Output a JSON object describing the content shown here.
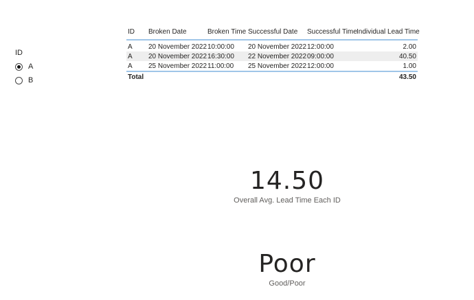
{
  "slicer": {
    "title": "ID",
    "options": [
      {
        "label": "A",
        "selected": true
      },
      {
        "label": "B",
        "selected": false
      }
    ]
  },
  "table": {
    "headers": [
      "ID",
      "Broken Date",
      "Broken Time",
      "Successful Date",
      "Successful Time",
      "Individual Lead Time"
    ],
    "rows": [
      [
        "A",
        "20 November 2022",
        "10:00:00",
        "20 November 2022",
        "12:00:00",
        "2.00"
      ],
      [
        "A",
        "20 November 2022",
        "16:30:00",
        "22 November 2022",
        "09:00:00",
        "40.50"
      ],
      [
        "A",
        "25 November 2022",
        "11:00:00",
        "25 November 2022",
        "12:00:00",
        "1.00"
      ]
    ],
    "total": {
      "label": "Total",
      "value": "43.50"
    }
  },
  "cards": {
    "avg": {
      "value": "14.50",
      "label": "Overall Avg. Lead Time Each ID"
    },
    "rating": {
      "value": "Poor",
      "label": "Good/Poor"
    }
  },
  "colors": {
    "table_accent": "#9fc5e8",
    "row_highlight": "#eeeeee"
  }
}
